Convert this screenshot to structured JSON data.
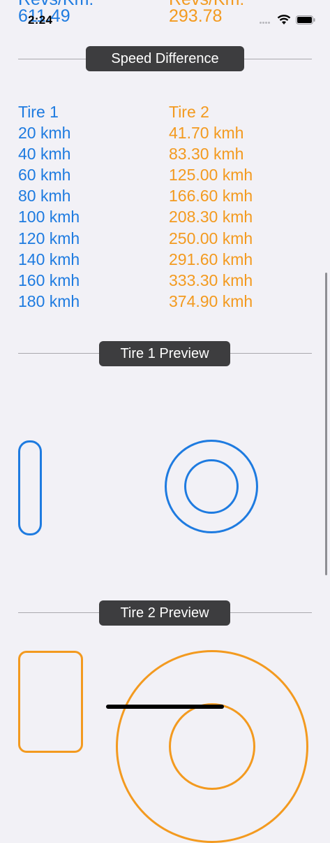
{
  "status_bar": {
    "time": "2:24"
  },
  "top_row": {
    "tire1_label_clipped": "Revs/Km:",
    "tire1_value": "611.49",
    "tire2_label_clipped": "Revs/Km:",
    "tire2_value": "293.78"
  },
  "speed_section": {
    "title": "Speed Difference",
    "tire1_header": "Tire 1",
    "tire2_header": "Tire 2",
    "tire1_speeds": [
      "20 kmh",
      "40 kmh",
      "60 kmh",
      "80 kmh",
      "100 kmh",
      "120 kmh",
      "140 kmh",
      "160 kmh",
      "180 kmh"
    ],
    "tire2_speeds": [
      "41.70 kmh",
      "83.30 kmh",
      "125.00 kmh",
      "166.60 kmh",
      "208.30 kmh",
      "250.00 kmh",
      "291.60 kmh",
      "333.30 kmh",
      "374.90 kmh"
    ]
  },
  "tire1_preview": {
    "title": "Tire 1 Preview"
  },
  "tire2_preview": {
    "title": "Tire 2 Preview"
  },
  "colors": {
    "tire1": "#1e7be0",
    "tire2": "#f39a1f",
    "background": "#f2f1f6",
    "pill": "#3d3d3f"
  }
}
